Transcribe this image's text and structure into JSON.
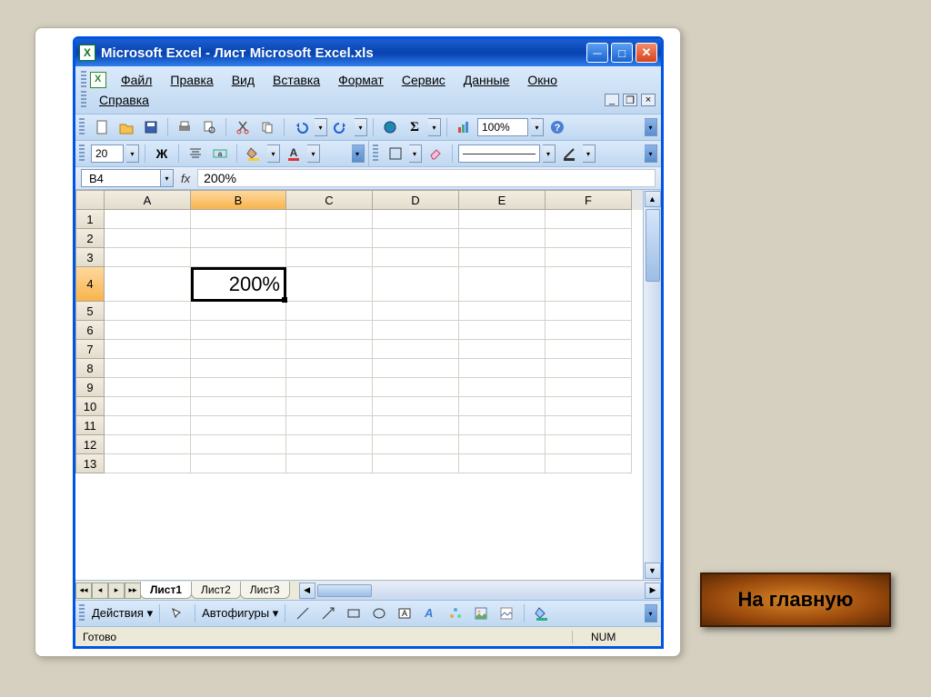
{
  "window": {
    "title": "Microsoft Excel - Лист Microsoft Excel.xls"
  },
  "menus": {
    "file": "Файл",
    "edit": "Правка",
    "view": "Вид",
    "insert": "Вставка",
    "format": "Формат",
    "tools": "Сервис",
    "data": "Данные",
    "window": "Окно",
    "help": "Справка"
  },
  "toolbar": {
    "zoom": "100%",
    "font_size": "20",
    "bold": "Ж"
  },
  "namebox": {
    "cell_ref": "B4",
    "fx": "fx",
    "formula": "200%"
  },
  "columns": [
    "A",
    "B",
    "C",
    "D",
    "E",
    "F"
  ],
  "rows": [
    "1",
    "2",
    "3",
    "4",
    "5",
    "6",
    "7",
    "8",
    "9",
    "10",
    "11",
    "12",
    "13"
  ],
  "active": {
    "col": "B",
    "row": "4",
    "value": "200%"
  },
  "sheets": {
    "s1": "Лист1",
    "s2": "Лист2",
    "s3": "Лист3"
  },
  "drawing": {
    "actions": "Действия",
    "autoshapes": "Автофигуры"
  },
  "status": {
    "ready": "Готово",
    "num": "NUM"
  },
  "home_button": "На главную"
}
